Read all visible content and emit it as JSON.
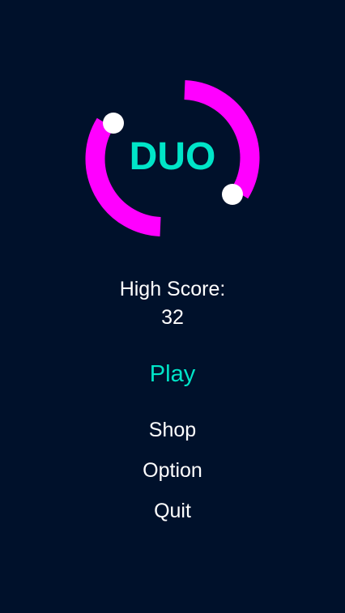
{
  "colors": {
    "background": "#00112B",
    "ring": "#FF00FF",
    "accent": "#00E5C8",
    "text": "#FFFFFF",
    "ball": "#FFFFFF"
  },
  "logo": {
    "title": "DUO"
  },
  "high_score": {
    "label": "High Score:",
    "value": "32"
  },
  "menu": {
    "play": "Play",
    "shop": "Shop",
    "option": "Option",
    "quit": "Quit"
  }
}
